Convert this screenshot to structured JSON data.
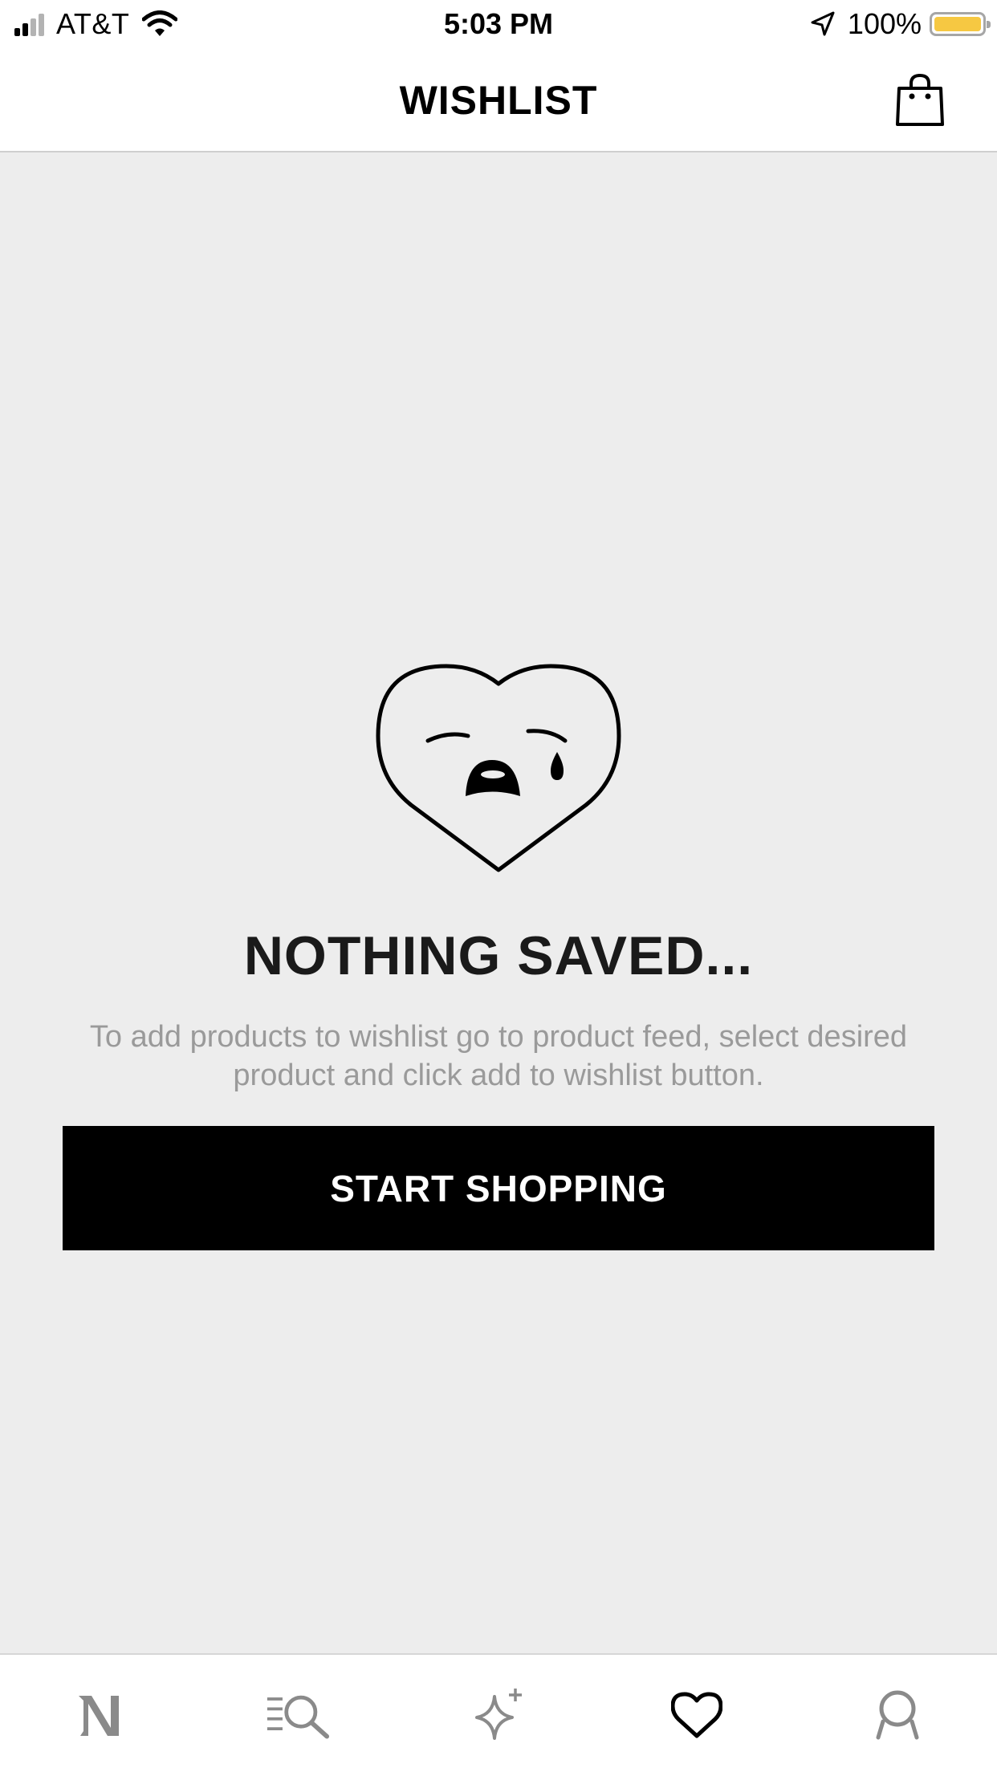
{
  "status_bar": {
    "carrier": "AT&T",
    "time": "5:03 PM",
    "battery": "100%",
    "battery_color": "#f6c842"
  },
  "header": {
    "title": "WISHLIST",
    "bag_icon": "shopping-bag-icon"
  },
  "empty_state": {
    "illustration": "crying-heart-icon",
    "title": "NOTHING SAVED...",
    "description": "To add products to wishlist go to product feed, select desired product and click add to wishlist button.",
    "button_label": "START SHOPPING"
  },
  "tab_bar": {
    "items": [
      {
        "icon": "brand-logo-n-icon",
        "active": false
      },
      {
        "icon": "catalog-search-icon",
        "active": false
      },
      {
        "icon": "sparkle-icon",
        "active": false
      },
      {
        "icon": "heart-icon",
        "active": true
      },
      {
        "icon": "profile-icon",
        "active": false
      }
    ],
    "active_color": "#000000",
    "inactive_color": "#8a8a8a"
  }
}
